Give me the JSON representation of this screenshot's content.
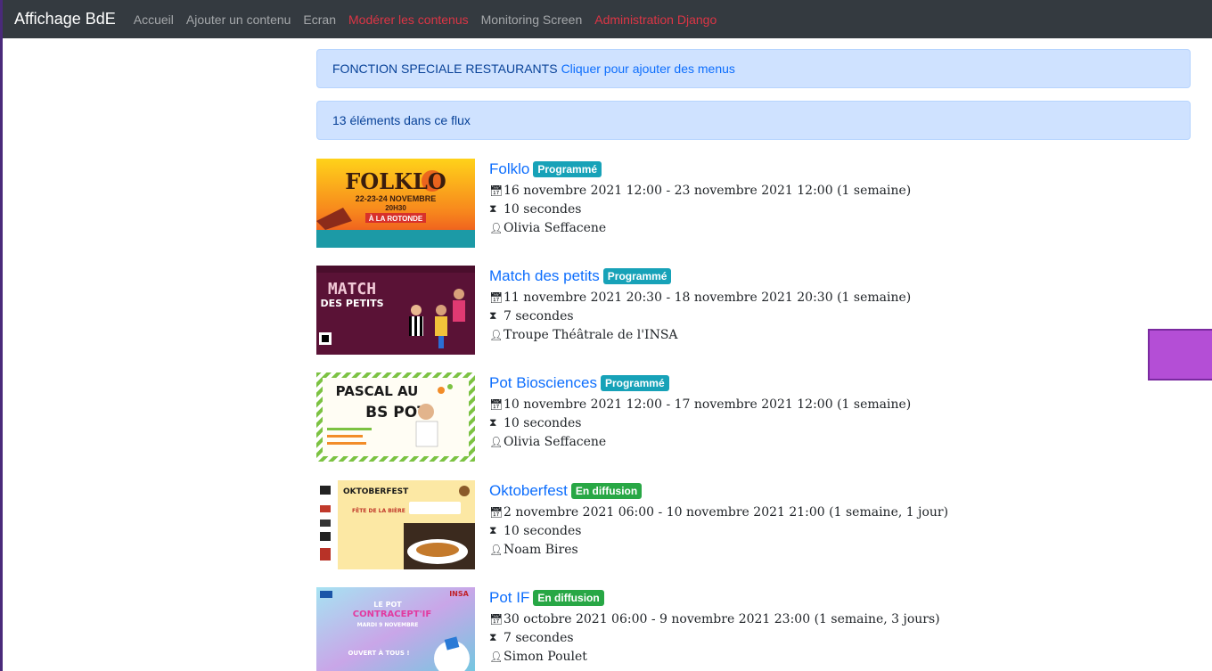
{
  "navbar": {
    "brand": "Affichage BdE",
    "links": [
      {
        "label": "Accueil",
        "style": "muted"
      },
      {
        "label": "Ajouter un contenu",
        "style": "muted"
      },
      {
        "label": "Ecran",
        "style": "muted"
      },
      {
        "label": "Modérer les contenus",
        "style": "danger"
      },
      {
        "label": "Monitoring Screen",
        "style": "muted"
      },
      {
        "label": "Administration Django",
        "style": "danger"
      }
    ]
  },
  "alerts": {
    "restaurants_text": "FONCTION SPECIALE RESTAURANTS",
    "restaurants_link": "Cliquer pour ajouter des menus",
    "count_text": "13 éléments dans ce flux"
  },
  "items": [
    {
      "title": "Folklo",
      "badge": "Programmé",
      "badge_type": "scheduled",
      "dates": "16 novembre 2021 12:00 - 23 novembre 2021 12:00 (1 semaine)",
      "duration": "10 secondes",
      "author": "Olivia Seffacene",
      "thumb": {
        "heading": "FOLKLO",
        "line1": "22-23-24 NOVEMBRE",
        "line2": "20H30",
        "line3": "À LA ROTONDE"
      }
    },
    {
      "title": "Match des petits",
      "badge": "Programmé",
      "badge_type": "scheduled",
      "dates": "11 novembre 2021 20:30 - 18 novembre 2021 20:30 (1 semaine)",
      "duration": "7 secondes",
      "author": "Troupe Théâtrale de l'INSA",
      "thumb": {
        "heading": "MATCH",
        "line1": "DES PETITS"
      }
    },
    {
      "title": "Pot Biosciences",
      "badge": "Programmé",
      "badge_type": "scheduled",
      "dates": "10 novembre 2021 12:00 - 17 novembre 2021 12:00 (1 semaine)",
      "duration": "10 secondes",
      "author": "Olivia Seffacene",
      "thumb": {
        "heading": "PASCAL AU",
        "line1": "BS POT"
      }
    },
    {
      "title": "Oktoberfest",
      "badge": "En diffusion",
      "badge_type": "live",
      "dates": "2 novembre 2021 06:00 - 10 novembre 2021 21:00 (1 semaine, 1 jour)",
      "duration": "10 secondes",
      "author": "Noam Bires",
      "thumb": {
        "heading": "OKTOBERFEST",
        "line1": "FÊTE DE LA BIÈRE"
      }
    },
    {
      "title": "Pot IF",
      "badge": "En diffusion",
      "badge_type": "live",
      "dates": "30 octobre 2021 06:00 - 9 novembre 2021 23:00 (1 semaine, 3 jours)",
      "duration": "7 secondes",
      "author": "Simon Poulet",
      "thumb": {
        "heading": "LE POT",
        "line1": "CONTRACEPT'IF",
        "line2": "MARDI 9 NOVEMBRE",
        "line3": "OUVERT À TOUS !",
        "logo": "INSA"
      }
    }
  ],
  "colors": {
    "navbar_bg": "#343a40",
    "link": "#0d6efd",
    "danger": "#dc3545",
    "badge_scheduled": "#17a2b8",
    "badge_live": "#28a745",
    "alert_bg": "#cfe2ff"
  },
  "icons": {
    "dates": "calendar-icon",
    "duration": "hourglass-icon",
    "author": "person-icon"
  }
}
